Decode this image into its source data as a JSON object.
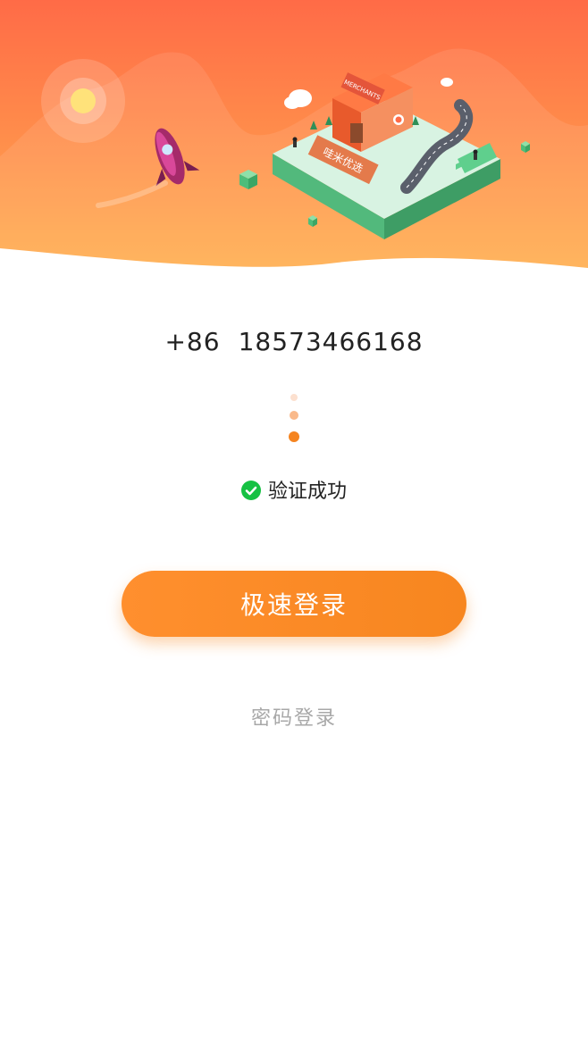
{
  "header": {
    "illustration": "isometric-shop-illustration",
    "shop_sign": "MERCHANTS",
    "shop_banner": "哇米优选",
    "colors": {
      "gradient_top": "#ff6e47",
      "gradient_bottom": "#ffa84b"
    }
  },
  "phone": {
    "country_code": "+86",
    "number": "18573466168"
  },
  "progress_dots": {
    "count": 3,
    "active_index": 2
  },
  "verification": {
    "icon": "check-circle-icon",
    "text": "验证成功",
    "color": "#16c143"
  },
  "login_button": {
    "label": "极速登录",
    "color": "#f7861f"
  },
  "password_login": {
    "label": "密码登录"
  }
}
